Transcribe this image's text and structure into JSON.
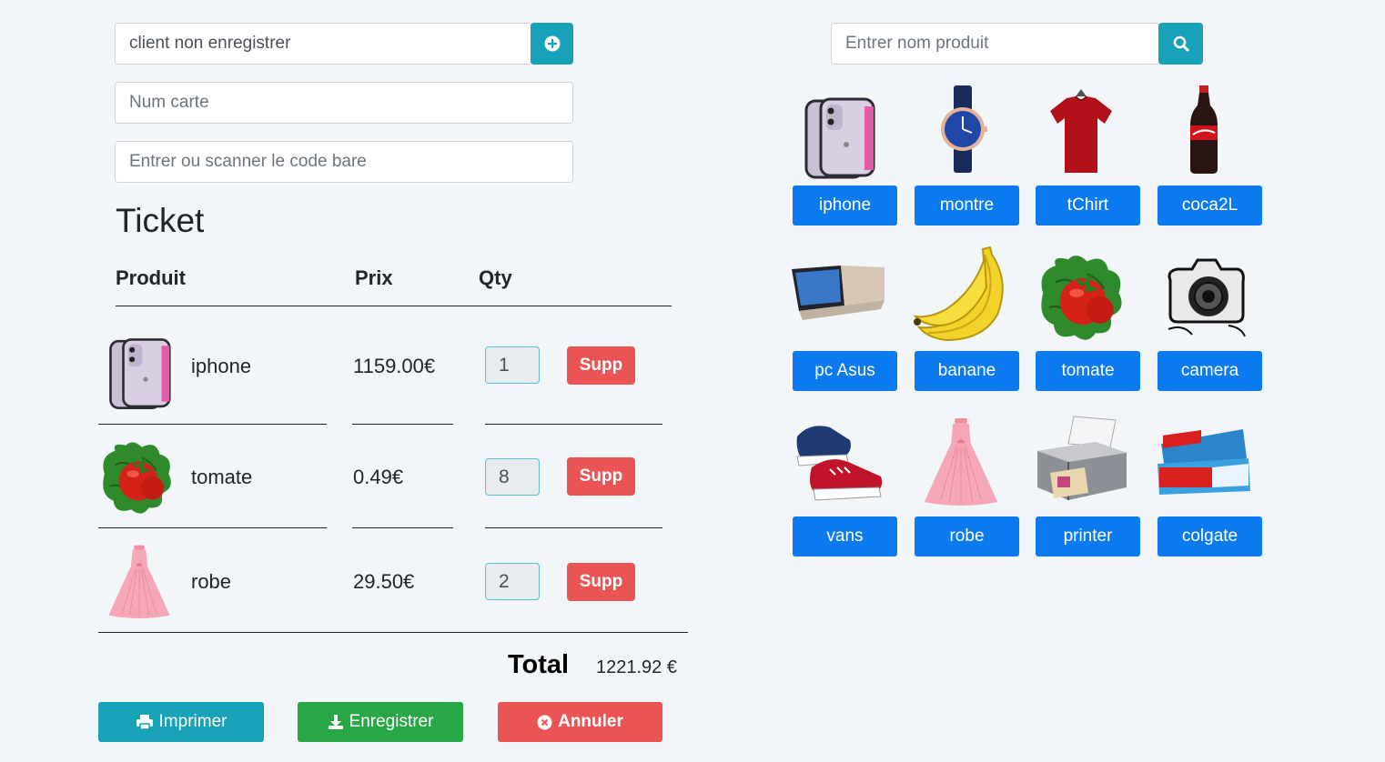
{
  "client": {
    "value": "client non enregistrer",
    "add_icon": "plus-circle-icon"
  },
  "card": {
    "placeholder": "Num carte"
  },
  "barcode": {
    "placeholder": "Entrer ou scanner le code bare"
  },
  "search": {
    "placeholder": "Entrer nom produit",
    "icon": "search-icon"
  },
  "ticket": {
    "title": "Ticket",
    "headers": {
      "product": "Produit",
      "price": "Prix",
      "qty": "Qty"
    },
    "rows": [
      {
        "name": "iphone",
        "price": "1159.00€",
        "qty": "1",
        "delete": "Supp",
        "image": "iphone"
      },
      {
        "name": "tomate",
        "price": "0.49€",
        "qty": "8",
        "delete": "Supp",
        "image": "tomato"
      },
      {
        "name": "robe",
        "price": "29.50€",
        "qty": "2",
        "delete": "Supp",
        "image": "dress"
      }
    ],
    "total_label": "Total",
    "total_value": "1221.92 €"
  },
  "actions": {
    "print": "Imprimer",
    "save": "Enregistrer",
    "cancel": "Annuler"
  },
  "colors": {
    "primary": "#0d7bf0",
    "info": "#17a2b8",
    "success": "#28a745",
    "danger": "#ea5455",
    "background": "#f3f6f9"
  },
  "products": [
    {
      "label": "iphone",
      "image": "iphone"
    },
    {
      "label": "montre",
      "image": "watch"
    },
    {
      "label": "tChirt",
      "image": "tshirt"
    },
    {
      "label": "coca2L",
      "image": "cola-bottle"
    },
    {
      "label": "pc Asus",
      "image": "laptop"
    },
    {
      "label": "banane",
      "image": "banana"
    },
    {
      "label": "tomate",
      "image": "tomato"
    },
    {
      "label": "camera",
      "image": "camera"
    },
    {
      "label": "vans",
      "image": "sneaker"
    },
    {
      "label": "robe",
      "image": "dress"
    },
    {
      "label": "printer",
      "image": "printer"
    },
    {
      "label": "colgate",
      "image": "toothpaste"
    }
  ]
}
